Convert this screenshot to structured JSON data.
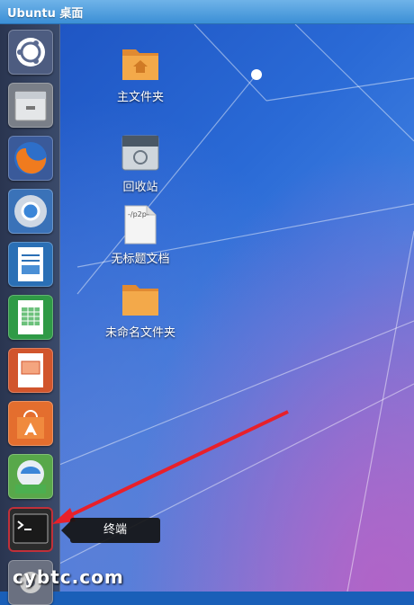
{
  "window": {
    "title": "Ubuntu 桌面"
  },
  "launcher": {
    "items": [
      {
        "name": "dash-home",
        "icon": "ubuntu-logo-icon"
      },
      {
        "name": "files",
        "icon": "file-cabinet-icon"
      },
      {
        "name": "firefox",
        "icon": "firefox-icon"
      },
      {
        "name": "chromium",
        "icon": "chromium-icon"
      },
      {
        "name": "writer",
        "icon": "libreoffice-writer-icon"
      },
      {
        "name": "calc",
        "icon": "libreoffice-calc-icon"
      },
      {
        "name": "impress",
        "icon": "libreoffice-impress-icon"
      },
      {
        "name": "software-center",
        "icon": "software-center-icon"
      },
      {
        "name": "empathy",
        "icon": "chat-icon"
      },
      {
        "name": "terminal",
        "icon": "terminal-icon"
      }
    ]
  },
  "desktop": {
    "icons": [
      {
        "label": "主文件夹",
        "icon": "home-folder-icon"
      },
      {
        "label": "回收站",
        "icon": "trash-icon"
      },
      {
        "label": "无标题文档",
        "icon": "document-icon",
        "glyph": "-/p2p-"
      },
      {
        "label": "未命名文件夹",
        "icon": "folder-icon"
      }
    ]
  },
  "tooltip": {
    "text": "终端"
  },
  "watermark": {
    "text": "cybtc.com"
  },
  "colors": {
    "titlebar": "#3b8fd6",
    "arrow": "#e8202a",
    "wallpaper": "#2a6ad6"
  }
}
